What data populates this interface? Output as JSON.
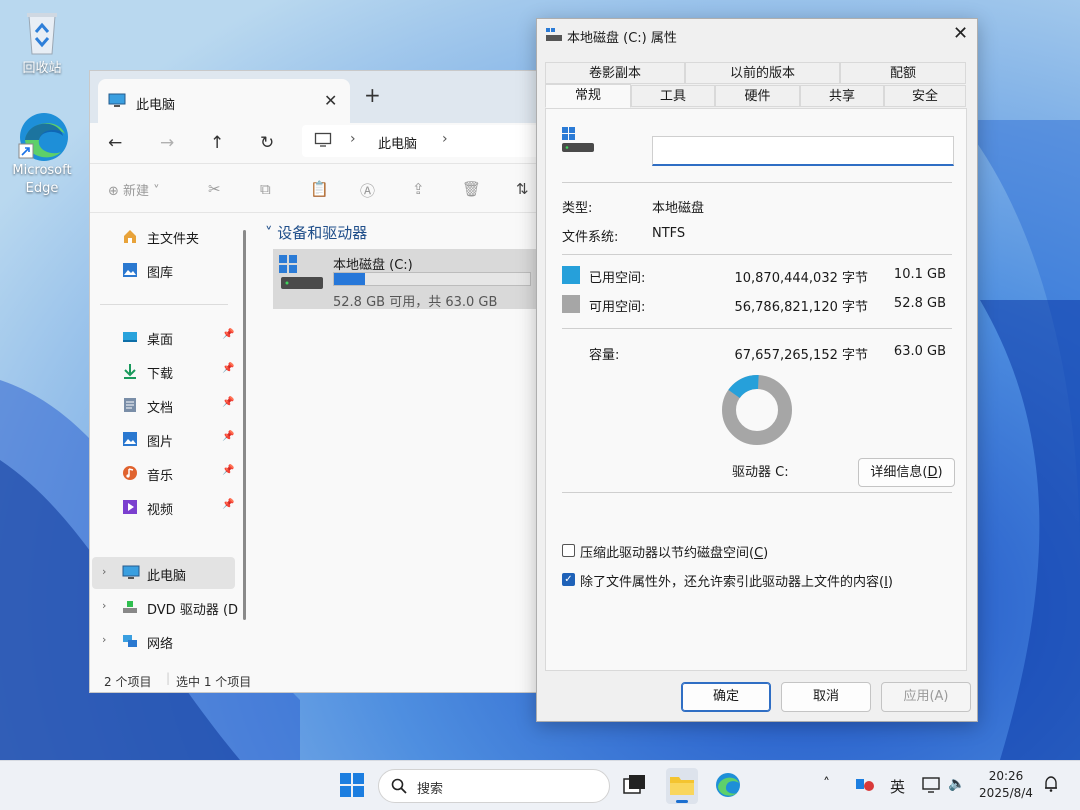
{
  "desktop": {
    "recycle_bin_label": "回收站",
    "edge_label_1": "Microsoft",
    "edge_label_2": "Edge"
  },
  "explorer": {
    "tab_label": "此电脑",
    "address_crumb": "此电脑",
    "new_label": "新建",
    "nav": {
      "home": "主文件夹",
      "gallery": "图库",
      "desktop": "桌面",
      "downloads": "下载",
      "documents": "文档",
      "pictures": "图片",
      "music": "音乐",
      "videos": "视频",
      "this_pc": "此电脑",
      "dvd": "DVD 驱动器 (D",
      "network": "网络"
    },
    "group_title": "设备和驱动器",
    "drive": {
      "name": "本地磁盘 (C:)",
      "size_text": "52.8 GB 可用，共 63.0 GB",
      "used_fraction": 0.16
    },
    "status": {
      "count": "2 个项目",
      "selected": "选中 1 个项目"
    }
  },
  "properties": {
    "title": "本地磁盘 (C:) 属性",
    "tabs_row1": [
      "卷影副本",
      "以前的版本",
      "配额"
    ],
    "tabs_row2": [
      "常规",
      "工具",
      "硬件",
      "共享",
      "安全"
    ],
    "active_tab": "常规",
    "type_label": "类型:",
    "type_value": "本地磁盘",
    "fs_label": "文件系统:",
    "fs_value": "NTFS",
    "used": {
      "label": "已用空间:",
      "bytes": "10,870,444,032 字节",
      "size": "10.1 GB",
      "color": "#26a0da"
    },
    "free": {
      "label": "可用空间:",
      "bytes": "56,786,821,120 字节",
      "size": "52.8 GB",
      "color": "#a6a6a6"
    },
    "capacity": {
      "label": "容量:",
      "bytes": "67,657,265,152 字节",
      "size": "63.0 GB"
    },
    "drive_label": "驱动器 C:",
    "details_button": "详细信息(",
    "details_key": "D",
    "details_close": ")",
    "compress": {
      "text": "压缩此驱动器以节约磁盘空间(",
      "key": "C",
      "close": ")",
      "checked": false
    },
    "index": {
      "text": "除了文件属性外，还允许索引此驱动器上文件的内容(",
      "key": "I",
      "close": ")",
      "checked": true
    },
    "buttons": {
      "ok": "确定",
      "cancel": "取消",
      "apply": "应用(A)"
    }
  },
  "taskbar": {
    "search_placeholder": "搜索",
    "ime": "英",
    "time": "20:26",
    "date": "2025/8/4"
  }
}
